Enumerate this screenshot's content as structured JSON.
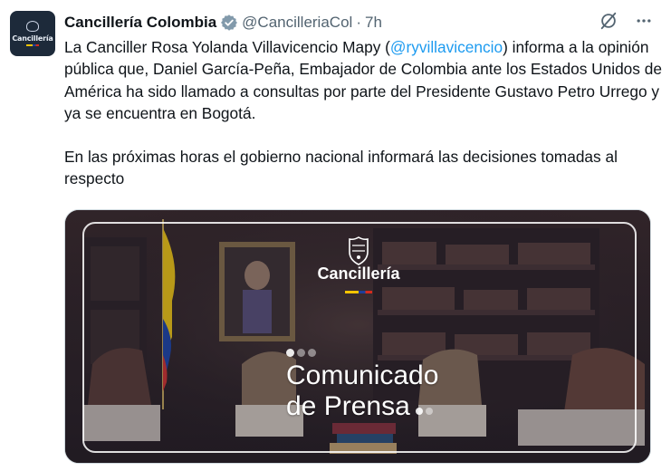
{
  "account": {
    "display_name": "Cancillería Colombia",
    "handle": "@CancilleriaCol",
    "separator": "·",
    "time": "7h",
    "avatar_text": "Cancillería"
  },
  "tweet": {
    "paragraph1_before": "La Canciller Rosa Yolanda Villavicencio Mapy (",
    "mention": "@ryvillavicencio",
    "paragraph1_after": ") informa a la opinión pública que, Daniel García-Peña, Embajador de Colombia ante los Estados Unidos de América ha sido llamado a consultas por parte del Presidente Gustavo Petro Urrego y ya se encuentra en Bogotá.",
    "paragraph2": "En las próximas horas el gobierno nacional informará las decisiones tomadas al respecto"
  },
  "media": {
    "brand": "Cancillería",
    "headline_line1": "Comunicado",
    "headline_line2": "de Prensa"
  },
  "icons": {
    "verified": "verified-badge-icon",
    "grok": "grok-icon",
    "more": "more-icon"
  },
  "colors": {
    "text": "#0f1419",
    "secondary": "#536471",
    "link": "#1d9bf0",
    "flag_yellow": "#f5c400",
    "flag_blue": "#1d3f9a",
    "flag_red": "#d52b1e"
  }
}
